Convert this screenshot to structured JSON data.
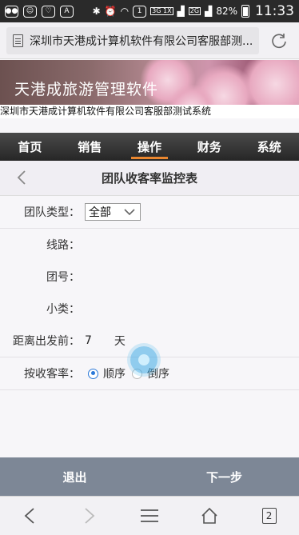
{
  "status_bar": {
    "signal_tags": [
      "3G 1X",
      "2G"
    ],
    "battery": "82%",
    "time": "11:33"
  },
  "address_bar": {
    "url_text": "深圳市天港成计算机软件有限公司客服部测..."
  },
  "banner": {
    "title": "天港成旅游管理软件",
    "subtitle": "深圳市天港成计算机软件有限公司客服部测试系统"
  },
  "nav": {
    "items": [
      "首页",
      "销售",
      "操作",
      "财务",
      "系统"
    ],
    "active": "操作"
  },
  "page": {
    "title": "团队收客率监控表"
  },
  "form": {
    "team_type": {
      "label": "团队类型：",
      "selected": "全部"
    },
    "route": {
      "label": "线路："
    },
    "group_no": {
      "label": "团号："
    },
    "subclass": {
      "label": "小类："
    },
    "days_before": {
      "label": "距离出发前：",
      "value": "7",
      "unit": "天"
    },
    "sort": {
      "label": "按收客率：",
      "options": [
        "顺序",
        "倒序"
      ],
      "selected": "顺序"
    }
  },
  "actions": {
    "exit_label": "退出",
    "next_label": "下一步"
  },
  "toolbar": {
    "tab_count": "2"
  }
}
